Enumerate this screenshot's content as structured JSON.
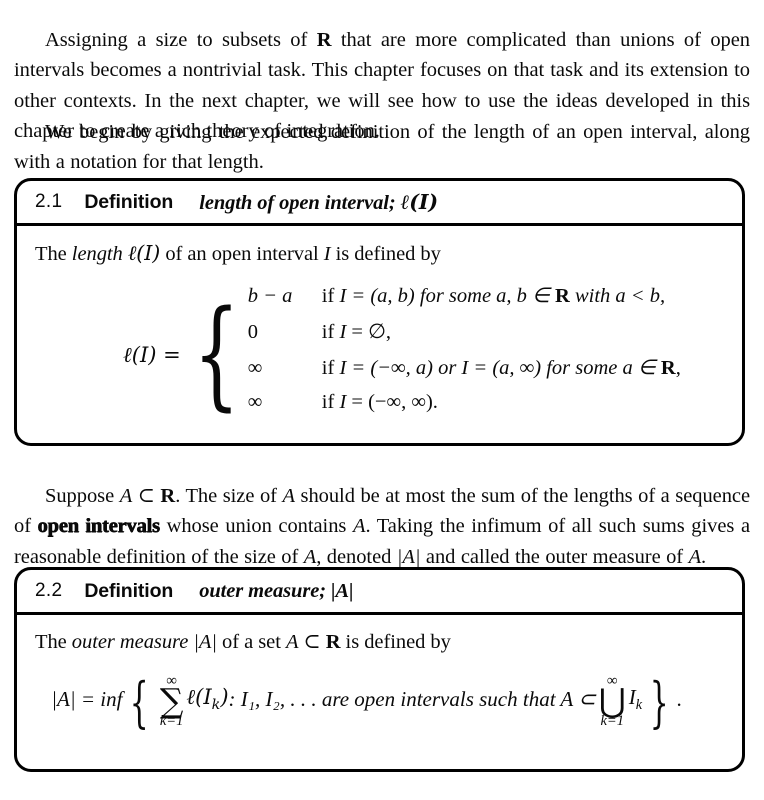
{
  "page": {
    "paragraphs": {
      "intro": {
        "part1": "Assigning a size to subsets of ",
        "symbol_R": "R",
        "part2": " that are more complicated than unions of open intervals becomes a nontrivial task. This chapter focuses on that task and its extension to other contexts. In the next chapter, we will see how to use the ideas developed in this chapter to create a rich theory of integration."
      },
      "begin": {
        "text": "We begin by giving the expected definition of the length of an open interval, along with a notation for that length."
      },
      "suppose": {
        "p1": "Suppose ",
        "sym_A": "A",
        "p2": " ⊂ ",
        "sym_R": "R",
        "p3": ". The size of ",
        "sym_A2": "A",
        "p4": " should be at most the sum of the lengths of a sequence of ",
        "emph_open_intervals": "open intervals",
        "p5": " whose union contains ",
        "sym_A3": "A",
        "p6": ". Taking the infimum of all such sums gives a reasonable definition of the size of ",
        "sym_A4": "A",
        "p7": ", denoted ",
        "sym_absA": "|A|",
        "p8": " and called the outer measure of ",
        "sym_A5": "A",
        "p9": "."
      }
    },
    "definitions": [
      {
        "number": "2.1",
        "keyword": "Definition",
        "title_plain": "length of open interval; ",
        "title_symbol": "ℓ(I)",
        "body": {
          "lead_p1": "The ",
          "lead_emph": "length ",
          "lead_symbol": "ℓ(I)",
          "lead_p2": " of an open interval ",
          "lead_var": "I",
          "lead_p3": " is defined by",
          "formula": {
            "lhs": "ℓ(I) =",
            "cases": [
              {
                "value": "b − a",
                "condition_p1": "if ",
                "condition_var": "I",
                "condition_p2": " = (a, b) for some a, b ∈ ",
                "condition_R": "R",
                "condition_p3": " with a < b,"
              },
              {
                "value": "0",
                "condition_p1": "if ",
                "condition_var": "I",
                "condition_p2": " = ∅,",
                "condition_R": "",
                "condition_p3": ""
              },
              {
                "value": "∞",
                "condition_p1": "if ",
                "condition_var": "I",
                "condition_p2": " = (−∞, a) or I = (a, ∞) for some a ∈ ",
                "condition_R": "R",
                "condition_p3": ","
              },
              {
                "value": "∞",
                "condition_p1": "if ",
                "condition_var": "I",
                "condition_p2": " = (−∞, ∞).",
                "condition_R": "",
                "condition_p3": ""
              }
            ]
          }
        }
      },
      {
        "number": "2.2",
        "keyword": "Definition",
        "title_plain": "outer measure; ",
        "title_symbol": "|A|",
        "body": {
          "lead_p1": "The ",
          "lead_emph": "outer measure ",
          "lead_symbol": "|A|",
          "lead_p2": " of a set ",
          "lead_var": "A",
          "lead_p3": " ⊂ ",
          "lead_R": "R",
          "lead_p4": " is defined by",
          "formula": {
            "lhs": "|A| = inf",
            "brace_open": "{",
            "sum_upper": "∞",
            "sum_glyph": "∑",
            "sum_lower": "k=1",
            "summand": "ℓ(I",
            "summand_sub": "k",
            "summand_close": ")",
            "middle_text": " : I₁, I₂, . . . are open intervals such that A ⊂ ",
            "union_upper": "∞",
            "union_glyph": "⋃",
            "union_lower": "k=1",
            "union_term": "I",
            "union_term_sub": "k",
            "brace_close": "}",
            "period": "."
          }
        }
      }
    ]
  }
}
